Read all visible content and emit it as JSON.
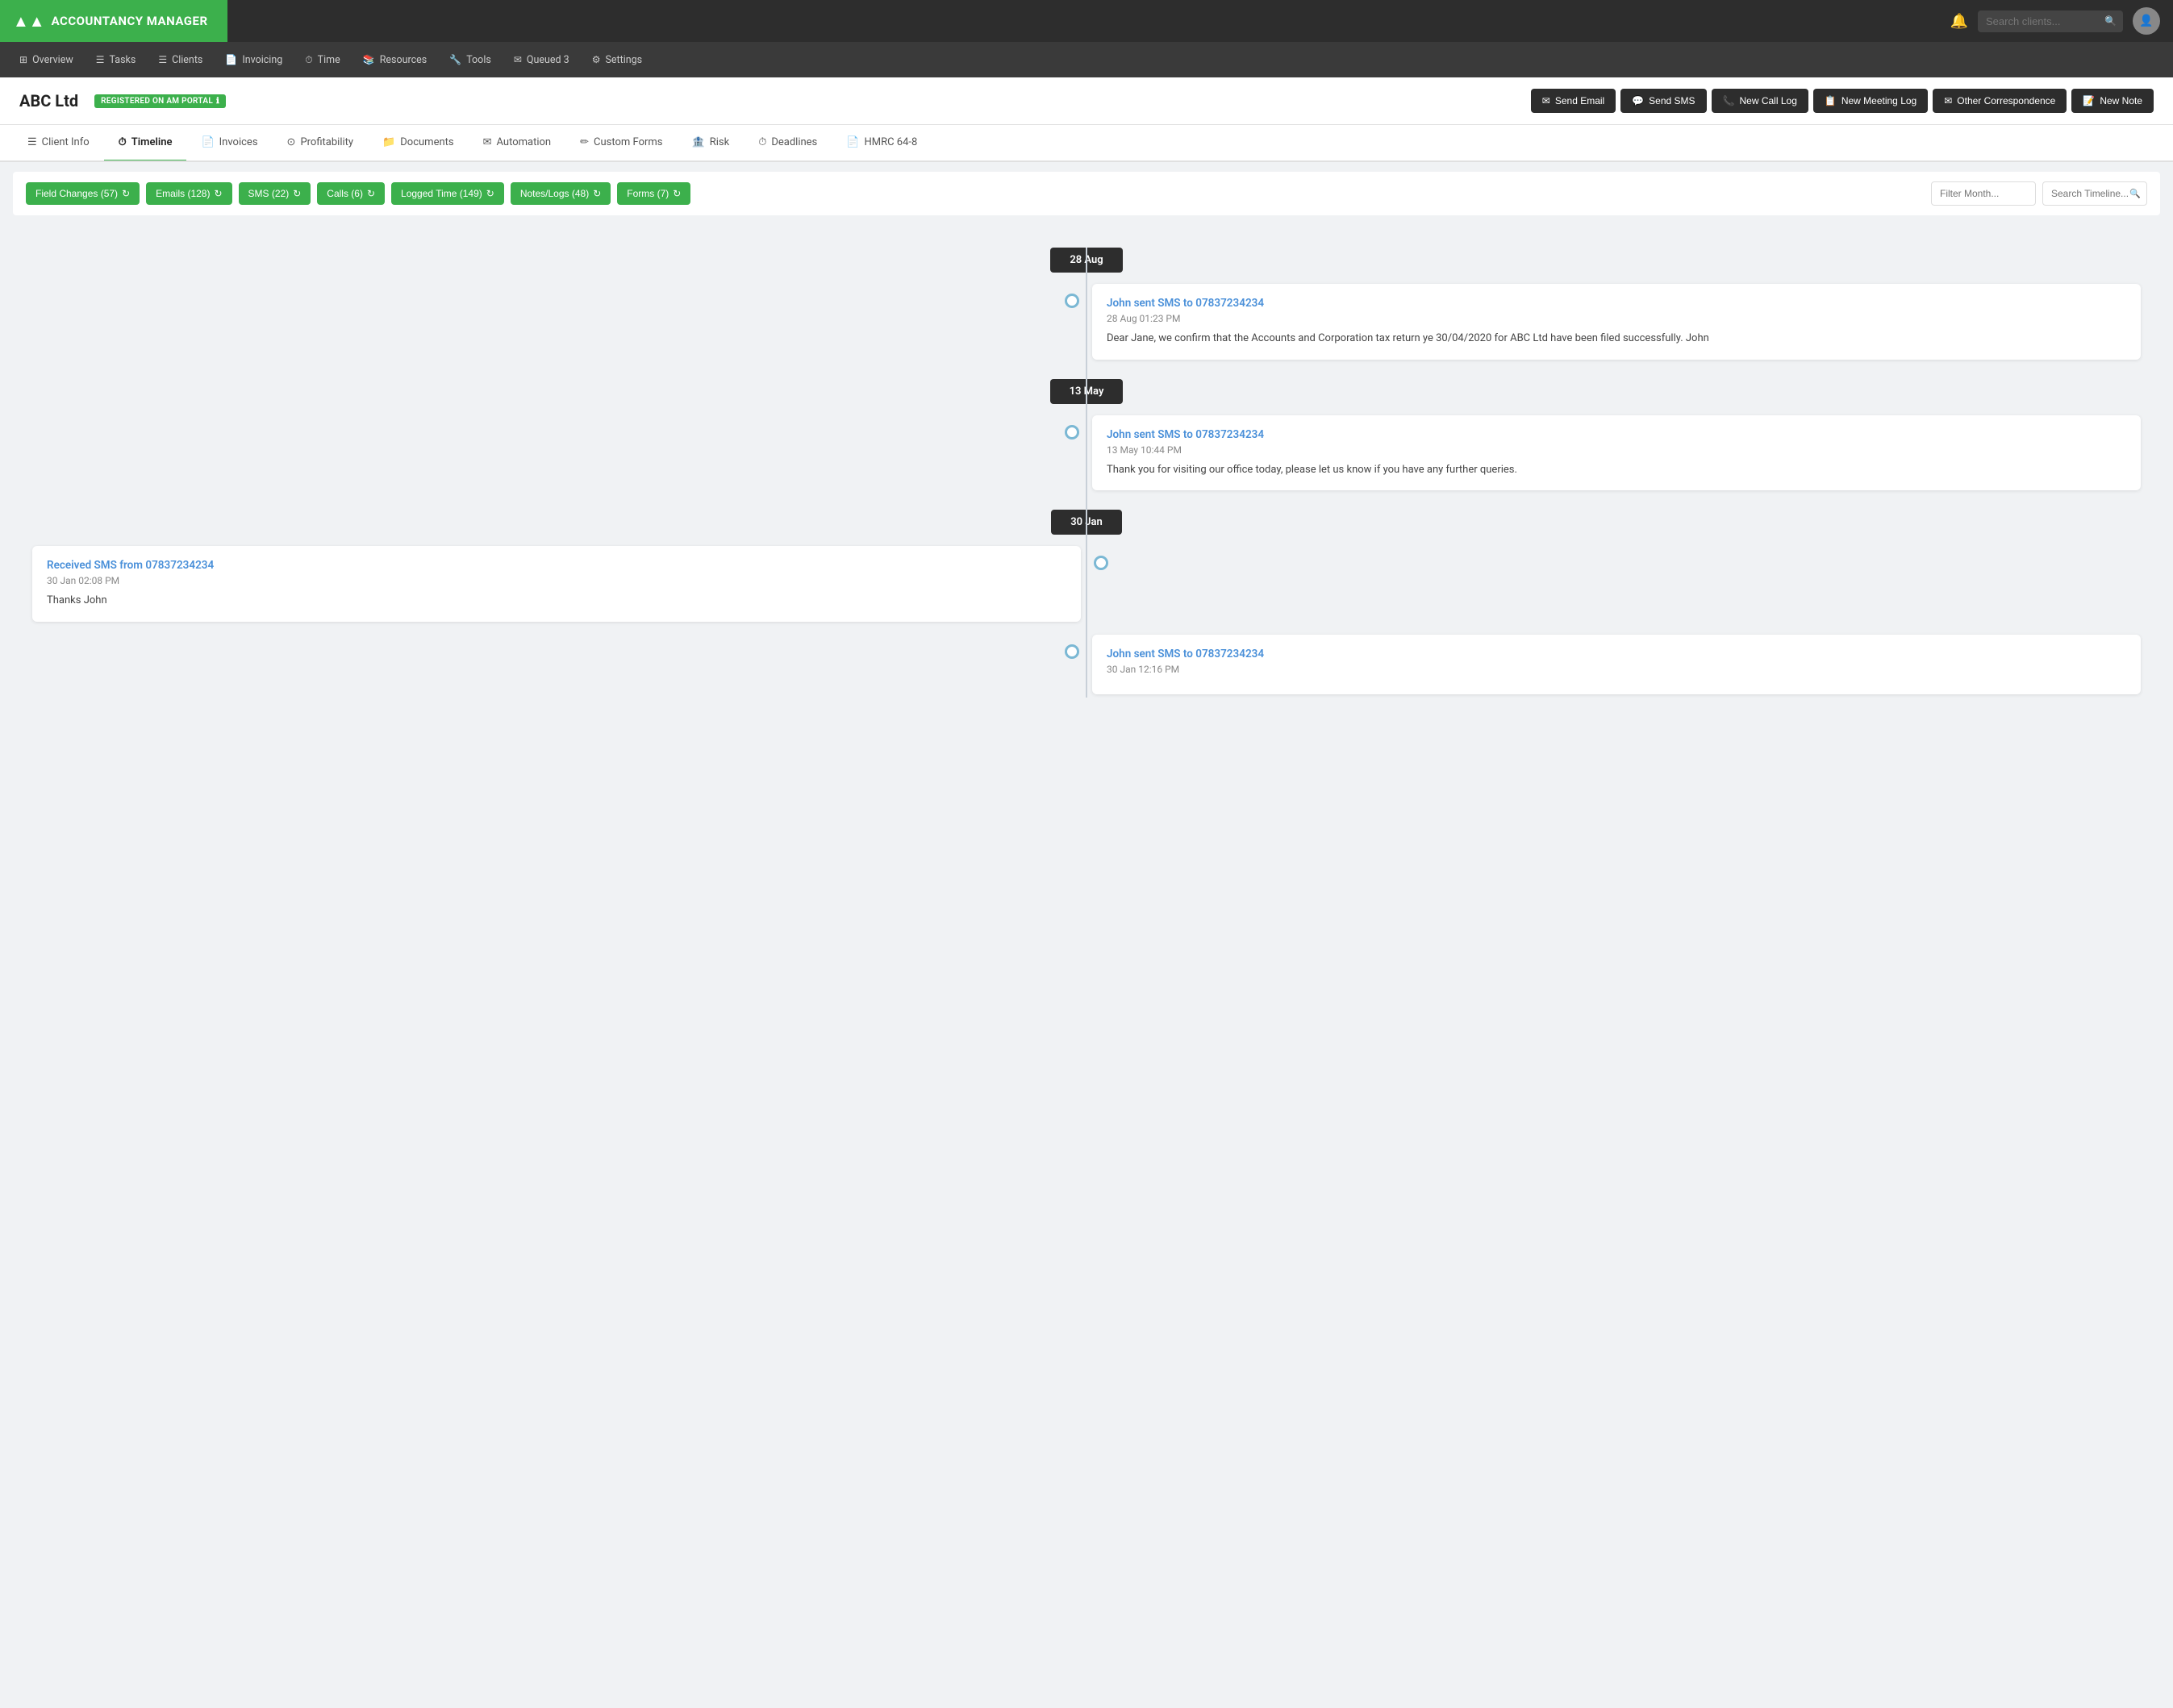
{
  "app": {
    "name": "ACCOUNTANCY MANAGER",
    "logo_icon": "▲▲"
  },
  "topnav": {
    "search_placeholder": "Search clients...",
    "bell_icon": "🔔"
  },
  "mainnav": {
    "items": [
      {
        "id": "overview",
        "label": "Overview",
        "icon": "⊞"
      },
      {
        "id": "tasks",
        "label": "Tasks",
        "icon": "☰"
      },
      {
        "id": "clients",
        "label": "Clients",
        "icon": "☰"
      },
      {
        "id": "invoicing",
        "label": "Invoicing",
        "icon": "📄"
      },
      {
        "id": "time",
        "label": "Time",
        "icon": "⏱"
      },
      {
        "id": "resources",
        "label": "Resources",
        "icon": "📚"
      },
      {
        "id": "tools",
        "label": "Tools",
        "icon": "🔧"
      },
      {
        "id": "queued",
        "label": "Queued 3",
        "icon": "✉"
      },
      {
        "id": "settings",
        "label": "Settings",
        "icon": "⚙"
      }
    ]
  },
  "client": {
    "name": "ABC Ltd",
    "badge": "REGISTERED ON AM PORTAL",
    "badge_icon": "ℹ"
  },
  "action_buttons": [
    {
      "id": "send-email",
      "label": "Send Email",
      "icon": "✉"
    },
    {
      "id": "send-sms",
      "label": "Send SMS",
      "icon": "💬"
    },
    {
      "id": "new-call-log",
      "label": "New Call Log",
      "icon": "📞"
    },
    {
      "id": "new-meeting-log",
      "label": "New Meeting Log",
      "icon": "📋"
    },
    {
      "id": "other-correspondence",
      "label": "Other Correspondence",
      "icon": "✉"
    },
    {
      "id": "new-note",
      "label": "New Note",
      "icon": "📝"
    }
  ],
  "tabs": [
    {
      "id": "client-info",
      "label": "Client Info",
      "icon": "☰",
      "active": false
    },
    {
      "id": "timeline",
      "label": "Timeline",
      "icon": "⏱",
      "active": true
    },
    {
      "id": "invoices",
      "label": "Invoices",
      "icon": "📄",
      "active": false
    },
    {
      "id": "profitability",
      "label": "Profitability",
      "icon": "⊙",
      "active": false
    },
    {
      "id": "documents",
      "label": "Documents",
      "icon": "📁",
      "active": false
    },
    {
      "id": "automation",
      "label": "Automation",
      "icon": "✉",
      "active": false
    },
    {
      "id": "custom-forms",
      "label": "Custom Forms",
      "icon": "✏",
      "active": false
    },
    {
      "id": "risk",
      "label": "Risk",
      "icon": "🏦",
      "active": false
    },
    {
      "id": "deadlines",
      "label": "Deadlines",
      "icon": "⏱",
      "active": false
    },
    {
      "id": "hmrc",
      "label": "HMRC 64-8",
      "icon": "📄",
      "active": false
    }
  ],
  "filters": [
    {
      "id": "field-changes",
      "label": "Field Changes (57)"
    },
    {
      "id": "emails",
      "label": "Emails (128)"
    },
    {
      "id": "sms",
      "label": "SMS (22)"
    },
    {
      "id": "calls",
      "label": "Calls (6)"
    },
    {
      "id": "logged-time",
      "label": "Logged Time (149)"
    },
    {
      "id": "notes-logs",
      "label": "Notes/Logs (48)"
    },
    {
      "id": "forms",
      "label": "Forms (7)"
    }
  ],
  "filter_month_placeholder": "Filter Month...",
  "search_timeline_placeholder": "Search Timeline...",
  "timeline": {
    "entries": [
      {
        "date_marker": "28 Aug",
        "items": [
          {
            "side": "right",
            "title": "John sent SMS to 07837234234",
            "time": "28 Aug 01:23 PM",
            "body": "Dear Jane, we confirm that the Accounts and Corporation tax return ye 30/04/2020 for ABC Ltd have been filed successfully. John"
          }
        ]
      },
      {
        "date_marker": "13 May",
        "items": [
          {
            "side": "right",
            "title": "John sent SMS to 07837234234",
            "time": "13 May 10:44 PM",
            "body": "Thank you for visiting our office today, please let us know if you have any further queries."
          }
        ]
      },
      {
        "date_marker": "30 Jan",
        "items": [
          {
            "side": "left",
            "title": "Received SMS from 07837234234",
            "time": "30 Jan 02:08 PM",
            "body": "Thanks John"
          },
          {
            "side": "right",
            "title": "John sent SMS to 07837234234",
            "time": "30 Jan 12:16 PM",
            "body": ""
          }
        ]
      }
    ]
  }
}
